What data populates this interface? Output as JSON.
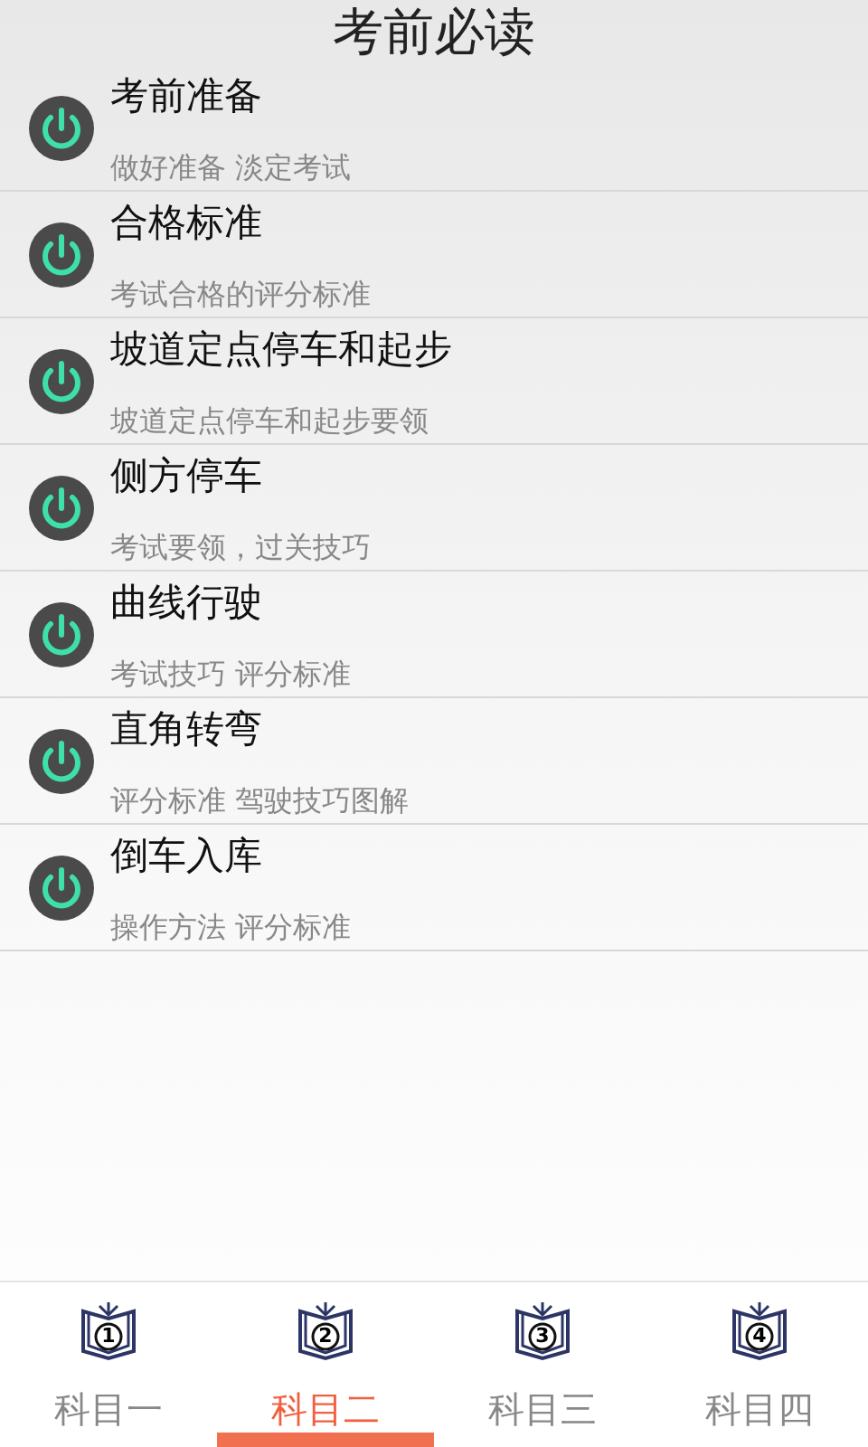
{
  "title": "考前必读",
  "items": [
    {
      "title": "考前准备",
      "subtitle": "做好准备 淡定考试"
    },
    {
      "title": "合格标准",
      "subtitle": "考试合格的评分标准"
    },
    {
      "title": "坡道定点停车和起步",
      "subtitle": "坡道定点停车和起步要领"
    },
    {
      "title": "侧方停车",
      "subtitle": "考试要领，过关技巧"
    },
    {
      "title": "曲线行驶",
      "subtitle": "考试技巧 评分标准"
    },
    {
      "title": "直角转弯",
      "subtitle": "评分标准 驾驶技巧图解"
    },
    {
      "title": "倒车入库",
      "subtitle": "操作方法 评分标准"
    }
  ],
  "tabs": [
    {
      "number": "1",
      "label": "科目一",
      "selected": false
    },
    {
      "number": "2",
      "label": "科目二",
      "selected": true
    },
    {
      "number": "3",
      "label": "科目三",
      "selected": false
    },
    {
      "number": "4",
      "label": "科目四",
      "selected": false
    }
  ]
}
